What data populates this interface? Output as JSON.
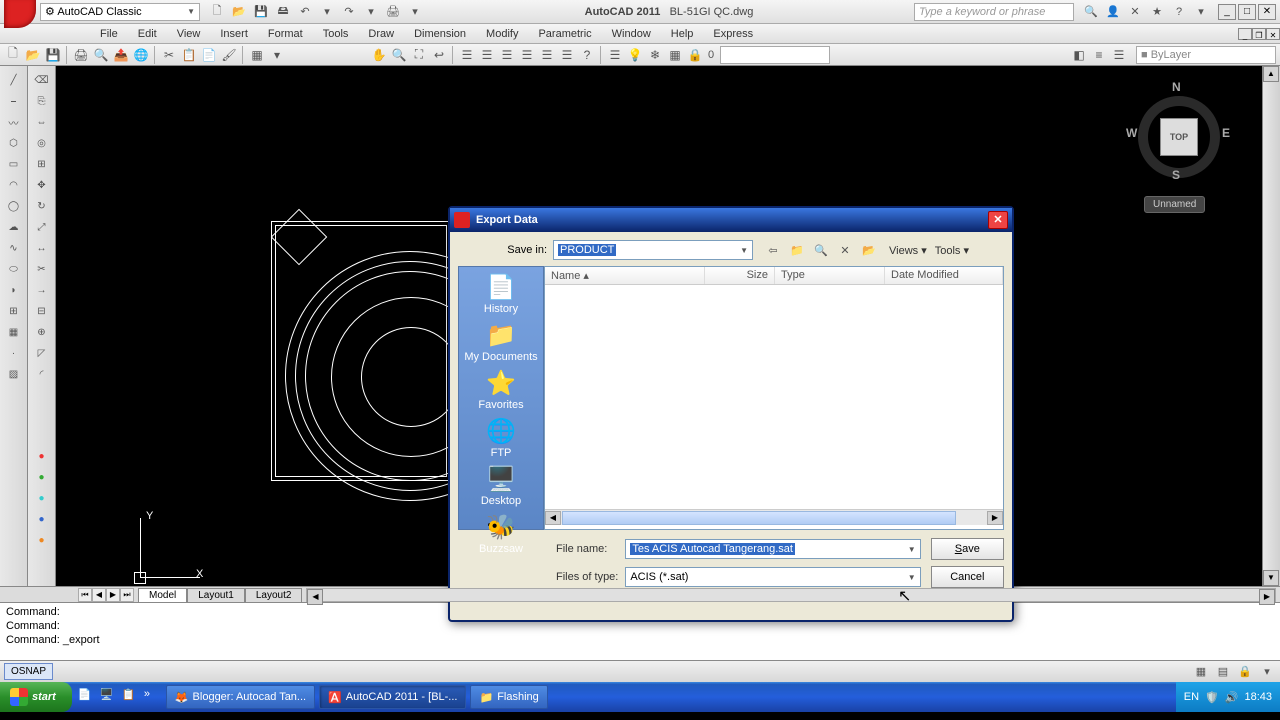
{
  "titlebar": {
    "workspace": "AutoCAD Classic",
    "app": "AutoCAD 2011",
    "doc": "BL-51GI QC.dwg",
    "search_placeholder": "Type a keyword or phrase"
  },
  "menu": [
    "File",
    "Edit",
    "View",
    "Insert",
    "Format",
    "Tools",
    "Draw",
    "Dimension",
    "Modify",
    "Parametric",
    "Window",
    "Help",
    "Express"
  ],
  "toolbar2": {
    "bylayer": "ByLayer",
    "zero": "0"
  },
  "viewcube": {
    "n": "N",
    "e": "E",
    "s": "S",
    "w": "W",
    "face": "TOP",
    "label": "Unnamed"
  },
  "axes": {
    "x": "X",
    "y": "Y"
  },
  "dialog": {
    "title": "Export Data",
    "savein_label": "Save in:",
    "savein_value": "PRODUCT",
    "views_label": "Views",
    "tools_label": "Tools",
    "places": [
      {
        "icon": "📄",
        "label": "History"
      },
      {
        "icon": "📁",
        "label": "My Documents"
      },
      {
        "icon": "⭐",
        "label": "Favorites"
      },
      {
        "icon": "🌐",
        "label": "FTP"
      },
      {
        "icon": "🖥️",
        "label": "Desktop"
      },
      {
        "icon": "🐝",
        "label": "Buzzsaw"
      }
    ],
    "columns": {
      "name": "Name",
      "size": "Size",
      "type": "Type",
      "date": "Date Modified"
    },
    "filename_label": "File name:",
    "filename_value": "Tes ACIS Autocad Tangerang.sat",
    "filetype_label": "Files of type:",
    "filetype_value": "ACIS (*.sat)",
    "save_btn": "Save",
    "cancel_btn": "Cancel"
  },
  "layout_tabs": [
    "Model",
    "Layout1",
    "Layout2"
  ],
  "command": {
    "line1": "Command:",
    "line2": "Command:",
    "line3": "Command: _export"
  },
  "statusbar": {
    "osnap": "OSNAP"
  },
  "taskbar": {
    "start": "start",
    "tasks": [
      {
        "icon": "🦊",
        "label": "Blogger: Autocad Tan..."
      },
      {
        "icon": "🅰️",
        "label": "AutoCAD 2011 - [BL-..."
      },
      {
        "icon": "📁",
        "label": "Flashing"
      }
    ],
    "lang": "EN",
    "time": "18:43"
  }
}
